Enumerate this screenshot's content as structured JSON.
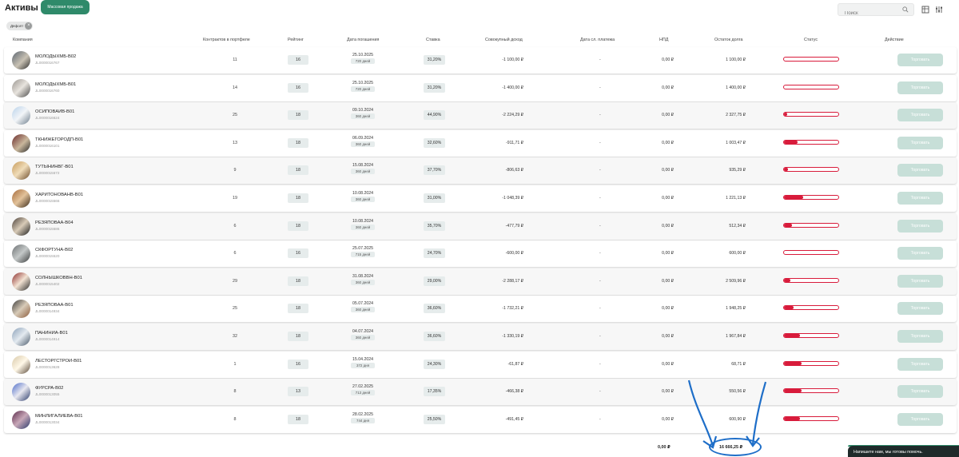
{
  "header": {
    "title": "Активы",
    "mass_sale_label": "Массовая продажа",
    "search_placeholder": "Поиск",
    "filter_chip": "Дефолт"
  },
  "columns": {
    "company": "Компания",
    "contracts": "Контрактов в портфеле",
    "rating": "Рейтинг",
    "maturity": "Дата погашения",
    "rate": "Ставка",
    "income": "Совокупный доход",
    "next_payment": "Дата сл. платежа",
    "npd": "НПД",
    "debt": "Остаток долга",
    "status": "Статус",
    "action": "Действие"
  },
  "rows": [
    {
      "name": "МОЛОДЫХМБ-B02",
      "code": "JL0000016767",
      "contracts": "11",
      "rating": "16",
      "date": "25.10.2025",
      "days": "720 дней",
      "rate": "31,20%",
      "income": "-1 100,00 ₽",
      "next": "-",
      "npd": "0,00 ₽",
      "debt": "1 100,00 ₽",
      "status_progress": 0.0,
      "action": "Торговать"
    },
    {
      "name": "МОЛОДЫХМБ-B01",
      "code": "JL0000016760",
      "contracts": "14",
      "rating": "16",
      "date": "25.10.2025",
      "days": "720 дней",
      "rate": "31,20%",
      "income": "-1 400,00 ₽",
      "next": "-",
      "npd": "0,00 ₽",
      "debt": "1 400,00 ₽",
      "status_progress": 0.0,
      "action": "Торговать"
    },
    {
      "name": "ОСИПОВАИВ-B01",
      "code": "JL0000016624",
      "contracts": "25",
      "rating": "18",
      "date": "09.10.2024",
      "days": "360 дней",
      "rate": "44,90%",
      "income": "-2 224,29 ₽",
      "next": "-",
      "npd": "0,00 ₽",
      "debt": "2 327,75 ₽",
      "status_progress": 0.06,
      "action": "Торговать"
    },
    {
      "name": "ТКНИЖЕГОРОДП-B01",
      "code": "JL0000016101",
      "contracts": "13",
      "rating": "18",
      "date": "06.09.2024",
      "days": "360 дней",
      "rate": "32,60%",
      "income": "-911,71 ₽",
      "next": "-",
      "npd": "0,00 ₽",
      "debt": "1 003,47 ₽",
      "status_progress": 0.25,
      "action": "Торговать"
    },
    {
      "name": "ТУТЫНИНВГ-B01",
      "code": "JL0000015672",
      "contracts": "9",
      "rating": "18",
      "date": "15.08.2024",
      "days": "360 дней",
      "rate": "37,70%",
      "income": "-806,63 ₽",
      "next": "-",
      "npd": "0,00 ₽",
      "debt": "935,29 ₽",
      "status_progress": 0.08,
      "action": "Торговать"
    },
    {
      "name": "ХАРИТОНОВАНВ-B01",
      "code": "JL0000015566",
      "contracts": "19",
      "rating": "18",
      "date": "10.08.2024",
      "days": "360 дней",
      "rate": "31,00%",
      "income": "-1 048,39 ₽",
      "next": "-",
      "npd": "0,00 ₽",
      "debt": "1 221,13 ₽",
      "status_progress": 0.35,
      "action": "Торговать"
    },
    {
      "name": "РЕЗЯПОВАА-B04",
      "code": "JL0000015586",
      "contracts": "6",
      "rating": "18",
      "date": "10.08.2024",
      "days": "360 дней",
      "rate": "35,70%",
      "income": "-477,79 ₽",
      "next": "-",
      "npd": "0,00 ₽",
      "debt": "512,34 ₽",
      "status_progress": 0.14,
      "action": "Торговать"
    },
    {
      "name": "СКФОРТУНА-B02",
      "code": "JL0000015520",
      "contracts": "6",
      "rating": "16",
      "date": "25.07.2025",
      "days": "715 дней",
      "rate": "24,70%",
      "income": "-600,00 ₽",
      "next": "-",
      "npd": "0,00 ₽",
      "debt": "600,00 ₽",
      "status_progress": 0.0,
      "action": "Торговать"
    },
    {
      "name": "СОЛНЫШКОВВН-B01",
      "code": "JL0000015402",
      "contracts": "29",
      "rating": "18",
      "date": "31.08.2024",
      "days": "360 дней",
      "rate": "29,00%",
      "income": "-2 288,17 ₽",
      "next": "-",
      "npd": "0,00 ₽",
      "debt": "2 509,96 ₽",
      "status_progress": 0.12,
      "action": "Торговать"
    },
    {
      "name": "РЕЗЯПОВАА-B01",
      "code": "JL0000014934",
      "contracts": "25",
      "rating": "18",
      "date": "05.07.2024",
      "days": "360 дней",
      "rate": "36,60%",
      "income": "-1 732,21 ₽",
      "next": "-",
      "npd": "0,00 ₽",
      "debt": "1 948,25 ₽",
      "status_progress": 0.18,
      "action": "Торговать"
    },
    {
      "name": "ПАНИНИА-B01",
      "code": "JL0000014914",
      "contracts": "32",
      "rating": "18",
      "date": "04.07.2024",
      "days": "360 дней",
      "rate": "36,60%",
      "income": "-1 330,19 ₽",
      "next": "-",
      "npd": "0,00 ₽",
      "debt": "1 967,84 ₽",
      "status_progress": 0.3,
      "action": "Торговать"
    },
    {
      "name": "ЛЕСТОРГСТРОИ-B01",
      "code": "JL0000013628",
      "contracts": "1",
      "rating": "16",
      "date": "15.04.2024",
      "days": "372 дня",
      "rate": "24,30%",
      "income": "-61,87 ₽",
      "next": "-",
      "npd": "0,00 ₽",
      "debt": "68,71 ₽",
      "status_progress": 0.32,
      "action": "Торговать"
    },
    {
      "name": "ФУРСРА-B02",
      "code": "JL0000013055",
      "contracts": "8",
      "rating": "13",
      "date": "27.02.2025",
      "days": "713 дней",
      "rate": "17,35%",
      "income": "-466,38 ₽",
      "next": "-",
      "npd": "0,00 ₽",
      "debt": "550,56 ₽",
      "status_progress": 0.33,
      "action": "Торговать"
    },
    {
      "name": "МИНЛИГАЛИЕВА-B01",
      "code": "JL0000013034",
      "contracts": "8",
      "rating": "18",
      "date": "28.02.2025",
      "days": "744 дня",
      "rate": "25,50%",
      "income": "-491,45 ₽",
      "next": "-",
      "npd": "0,00 ₽",
      "debt": "600,90 ₽",
      "status_progress": 0.3,
      "action": "Торговать"
    }
  ],
  "totals": {
    "npd": "0,00 ₽",
    "debt": "16 666,25 ₽"
  },
  "chat": {
    "label": "Напишите нам, мы готовы помочь."
  },
  "colors": {
    "accent": "#2f8a6a",
    "status_bar": "#d81b3b",
    "annotation": "#1e6ec8"
  }
}
